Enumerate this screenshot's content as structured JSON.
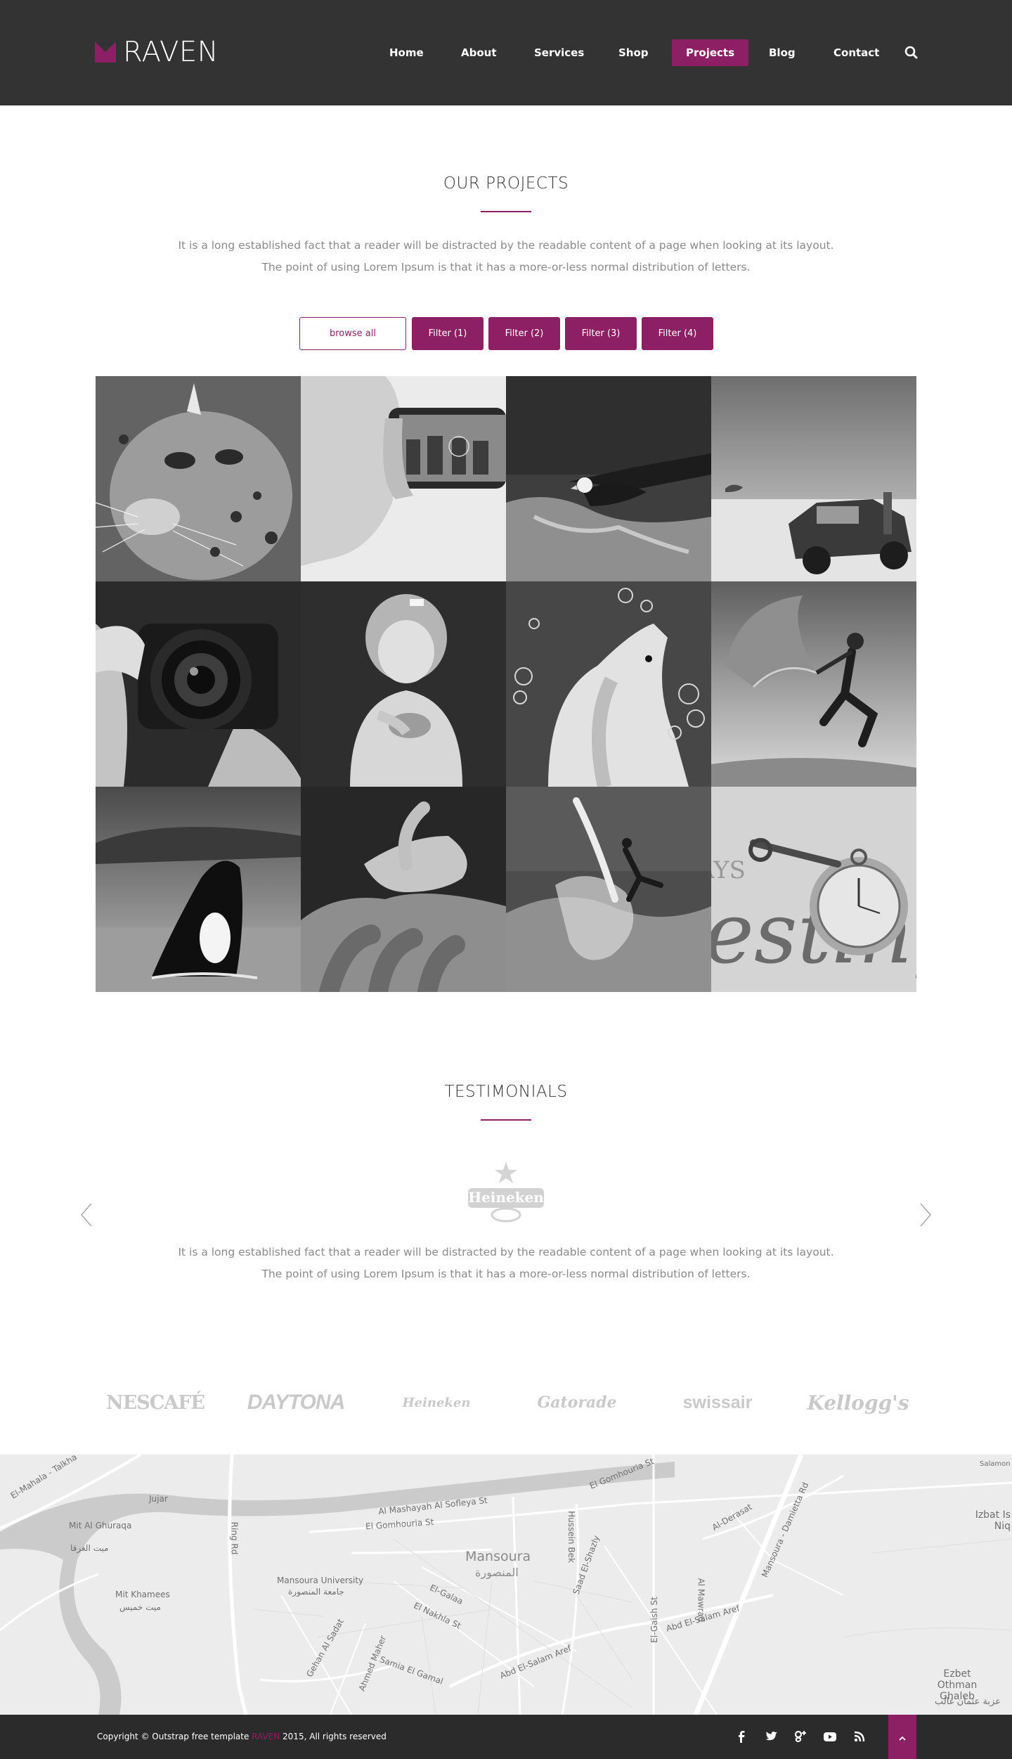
{
  "header": {
    "logo_text": "RAVEN",
    "nav": [
      {
        "label": "Home",
        "active": false
      },
      {
        "label": "About",
        "active": false
      },
      {
        "label": "Services",
        "active": false
      },
      {
        "label": "Shop",
        "active": false
      },
      {
        "label": "Projects",
        "active": true
      },
      {
        "label": "Blog",
        "active": false
      },
      {
        "label": "Contact",
        "active": false
      }
    ],
    "search_icon": "search-icon"
  },
  "colors": {
    "accent": "#8d2064",
    "header_bg": "#333333",
    "footer_bg": "#2b2b2b"
  },
  "projects": {
    "title": "OUR PROJECTS",
    "lead_line1": "It is a long established fact that a reader will be distracted by the readable content of a page when looking at its layout.",
    "lead_line2": "The point of using Lorem Ipsum is that it has a more-or-less normal distribution of letters.",
    "filters": [
      "browse all",
      "Filter (1)",
      "Filter (2)",
      "Filter (3)",
      "Filter (4)"
    ],
    "tiles": [
      "ocelot",
      "hand-holding-phone",
      "eagle",
      "old-car",
      "camera",
      "little-girl",
      "dog-bubbles",
      "dancer",
      "orca",
      "hands",
      "surfer",
      "pocket-watch"
    ]
  },
  "testimonials": {
    "title": "TESTIMONIALS",
    "logo_text": "Heineken",
    "quote_line1": "It is a long established fact that a reader will be distracted by the readable content of a page when looking at its layout.",
    "quote_line2": "The point of using Lorem Ipsum is that it has a more-or-less normal distribution of letters.",
    "prev_icon": "chevron-left-icon",
    "next_icon": "chevron-right-icon"
  },
  "clients": [
    "NESCAFÉ",
    "DAYTONA",
    "Heineken",
    "Gatorade",
    "swissair",
    "Kellogg's"
  ],
  "map": {
    "labels": [
      "El-Mahala - Talkha",
      "Jujar",
      "Mit Al Ghuraqa",
      "ميت الغرقا",
      "Mit Khamees",
      "ميت خميس",
      "Ring Rd",
      "Al Mashayah Al Sofleya St",
      "El Gomhouria St",
      "Mansoura",
      "المنصورة",
      "Mansoura University",
      "جامعة المنصورة",
      "El-Galaa",
      "El Nakhla St",
      "Gehan Al Sadat",
      "Ahmed Maher",
      "Samia El Gamal",
      "Abd El-Salam Aref",
      "Hussein Bek",
      "Saad El-Shazly",
      "El-Gaish St",
      "Al Mawrad",
      "Abd El-Salam Aref",
      "Mansoura - Damietta Rd",
      "Al-Derasat",
      "Izbat Is Niq",
      "Ezbet Othman Ghaleb",
      "عزبة عثمان غالب",
      "El Gomhouria St",
      "Salamon"
    ]
  },
  "footer": {
    "copyright_prefix": "Copyright © Outstrap free template ",
    "copyright_brand": "RAVEN",
    "copyright_suffix": " 2015, All rights reserved",
    "social_icons": [
      "facebook-icon",
      "twitter-icon",
      "google-plus-icon",
      "youtube-icon",
      "rss-icon"
    ],
    "to_top_icon": "chevron-up-icon"
  }
}
